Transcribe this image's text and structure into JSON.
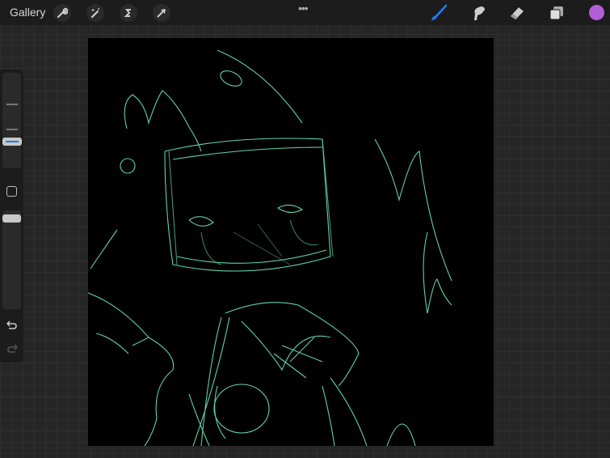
{
  "topbar": {
    "gallery_label": "Gallery",
    "more_label": "•••",
    "active_color": "#b45fd8",
    "brush_color": "#1e7ff0"
  },
  "sidebar": {
    "brush_size_fraction": 0.6,
    "opacity_fraction": 1.0
  },
  "canvas": {
    "background": "#000000",
    "stroke_color": "#5fd3a8"
  }
}
